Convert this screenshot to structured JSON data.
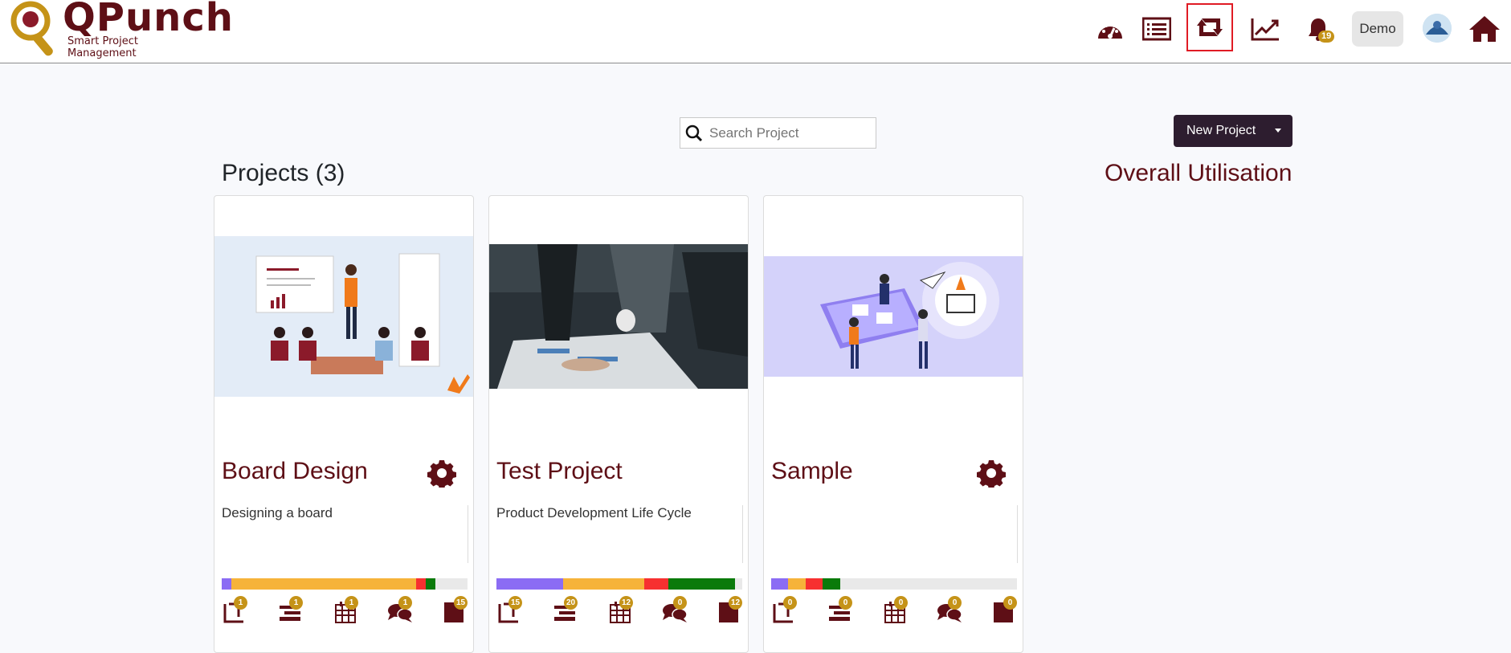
{
  "brand": {
    "name": "QPunch",
    "tagline": "Smart Project Management"
  },
  "nav": {
    "icons": [
      "dashboard-gauge-icon",
      "list-icon",
      "retweet-icon",
      "line-chart-icon",
      "bell-icon",
      "avatar",
      "home-icon"
    ],
    "notifications": "19",
    "user_label": "Demo"
  },
  "search": {
    "placeholder": "Search Project"
  },
  "new_project_label": "New Project",
  "projects_heading": "Projects (3)",
  "utilisation_heading": "Overall Utilisation",
  "colors": {
    "brand": "#5e0f16",
    "badge": "#c59318",
    "purple": "#8b6cf4",
    "orange": "#f6b33a",
    "red": "#f73030",
    "green": "#0a7a0a",
    "empty": "#e9e9e9"
  },
  "projects": [
    {
      "title": "Board Design",
      "description": "Designing a board",
      "has_settings": true,
      "progress": {
        "purple": 0.04,
        "orange": 0.75,
        "red": 0.04,
        "green": 0.04
      },
      "counts": [
        "1",
        "1",
        "1",
        "1",
        "15"
      ]
    },
    {
      "title": "Test Project",
      "description": "Product Development Life Cycle",
      "has_settings": false,
      "progress": {
        "purple": 0.24,
        "orange": 0.29,
        "red": 0.09,
        "green": 0.24
      },
      "counts": [
        "15",
        "20",
        "12",
        "0",
        "12"
      ]
    },
    {
      "title": "Sample",
      "description": "",
      "has_settings": true,
      "progress": {
        "purple": 0.07,
        "orange": 0.07,
        "red": 0.07,
        "green": 0.07
      },
      "counts": [
        "0",
        "0",
        "0",
        "0",
        "0"
      ]
    }
  ]
}
